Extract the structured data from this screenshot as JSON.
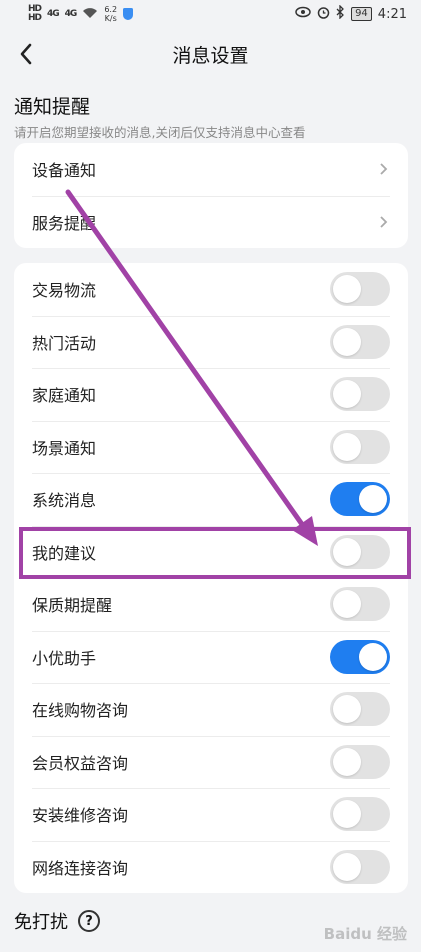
{
  "status_bar": {
    "hd1": "HD",
    "hd2": "HD",
    "sig1": "4G",
    "sig2": "4G",
    "speed_value": "6.2",
    "speed_unit": "K/s",
    "battery": "94",
    "time": "4:21"
  },
  "header": {
    "title": "消息设置"
  },
  "notification": {
    "title": "通知提醒",
    "subtitle": "请开启您期望接收的消息,关闭后仅支持消息中心查看"
  },
  "nav_items": [
    {
      "label": "设备通知"
    },
    {
      "label": "服务提醒"
    }
  ],
  "toggle_items": [
    {
      "label": "交易物流",
      "on": false
    },
    {
      "label": "热门活动",
      "on": false
    },
    {
      "label": "家庭通知",
      "on": false
    },
    {
      "label": "场景通知",
      "on": false
    },
    {
      "label": "系统消息",
      "on": true
    },
    {
      "label": "我的建议",
      "on": false
    },
    {
      "label": "保质期提醒",
      "on": false
    },
    {
      "label": "小优助手",
      "on": true
    },
    {
      "label": "在线购物咨询",
      "on": false
    },
    {
      "label": "会员权益咨询",
      "on": false
    },
    {
      "label": "安装维修咨询",
      "on": false
    },
    {
      "label": "网络连接咨询",
      "on": false
    }
  ],
  "dnd": {
    "title": "免打扰",
    "help": "?"
  },
  "watermark": "Baidu 经验",
  "colors": {
    "toggle_on": "#1f7ef0",
    "toggle_off": "#e2e2e2",
    "annotation": "#a142a6"
  },
  "icons": {
    "back": "chevron-left-icon",
    "nav": "chevron-right-icon",
    "help": "question-circle-icon"
  }
}
